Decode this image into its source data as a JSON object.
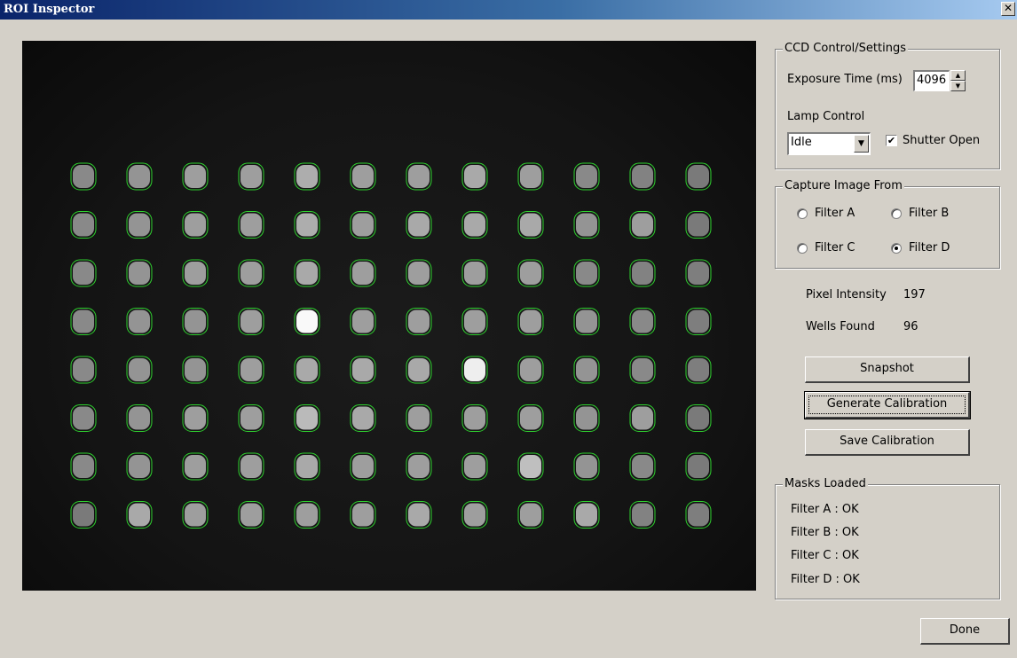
{
  "window": {
    "title": "ROI Inspector",
    "close_glyph": "✕"
  },
  "plate": {
    "wells_brightness": [
      [
        0.45,
        0.5,
        0.55,
        0.55,
        0.62,
        0.55,
        0.55,
        0.6,
        0.55,
        0.45,
        0.42,
        0.38
      ],
      [
        0.45,
        0.5,
        0.55,
        0.55,
        0.62,
        0.55,
        0.6,
        0.6,
        0.6,
        0.5,
        0.55,
        0.38
      ],
      [
        0.45,
        0.5,
        0.55,
        0.55,
        0.6,
        0.55,
        0.55,
        0.55,
        0.55,
        0.45,
        0.42,
        0.4
      ],
      [
        0.45,
        0.5,
        0.5,
        0.55,
        0.97,
        0.55,
        0.55,
        0.55,
        0.55,
        0.5,
        0.45,
        0.4
      ],
      [
        0.45,
        0.5,
        0.5,
        0.55,
        0.6,
        0.6,
        0.6,
        0.92,
        0.55,
        0.5,
        0.45,
        0.4
      ],
      [
        0.45,
        0.5,
        0.55,
        0.55,
        0.68,
        0.6,
        0.55,
        0.55,
        0.55,
        0.5,
        0.55,
        0.38
      ],
      [
        0.45,
        0.5,
        0.55,
        0.55,
        0.6,
        0.55,
        0.55,
        0.55,
        0.7,
        0.5,
        0.45,
        0.38
      ],
      [
        0.38,
        0.6,
        0.55,
        0.55,
        0.55,
        0.55,
        0.6,
        0.55,
        0.55,
        0.6,
        0.42,
        0.4
      ]
    ],
    "outline_color": "#2fd12f"
  },
  "ccd": {
    "legend": "CCD Control/Settings",
    "exposure_label": "Exposure Time (ms)",
    "exposure_value": "4096",
    "lamp_label": "Lamp Control",
    "lamp_value": "Idle",
    "shutter_label": "Shutter Open",
    "shutter_checked": true,
    "check_glyph": "✔",
    "spin_up": "▲",
    "spin_down": "▼",
    "combo_arrow": "▼"
  },
  "capture": {
    "legend": "Capture Image From",
    "options": [
      "Filter A",
      "Filter B",
      "Filter C",
      "Filter D"
    ],
    "selected": "Filter D"
  },
  "stats": {
    "intensity_label": "Pixel Intensity",
    "intensity_value": "197",
    "wells_label": "Wells Found",
    "wells_value": "96"
  },
  "buttons": {
    "snapshot": "Snapshot",
    "generate": "Generate Calibration",
    "save": "Save Calibration",
    "done": "Done"
  },
  "masks": {
    "legend": "Masks Loaded",
    "items": [
      "Filter A : OK",
      "Filter B : OK",
      "Filter C : OK",
      "Filter D : OK"
    ]
  }
}
